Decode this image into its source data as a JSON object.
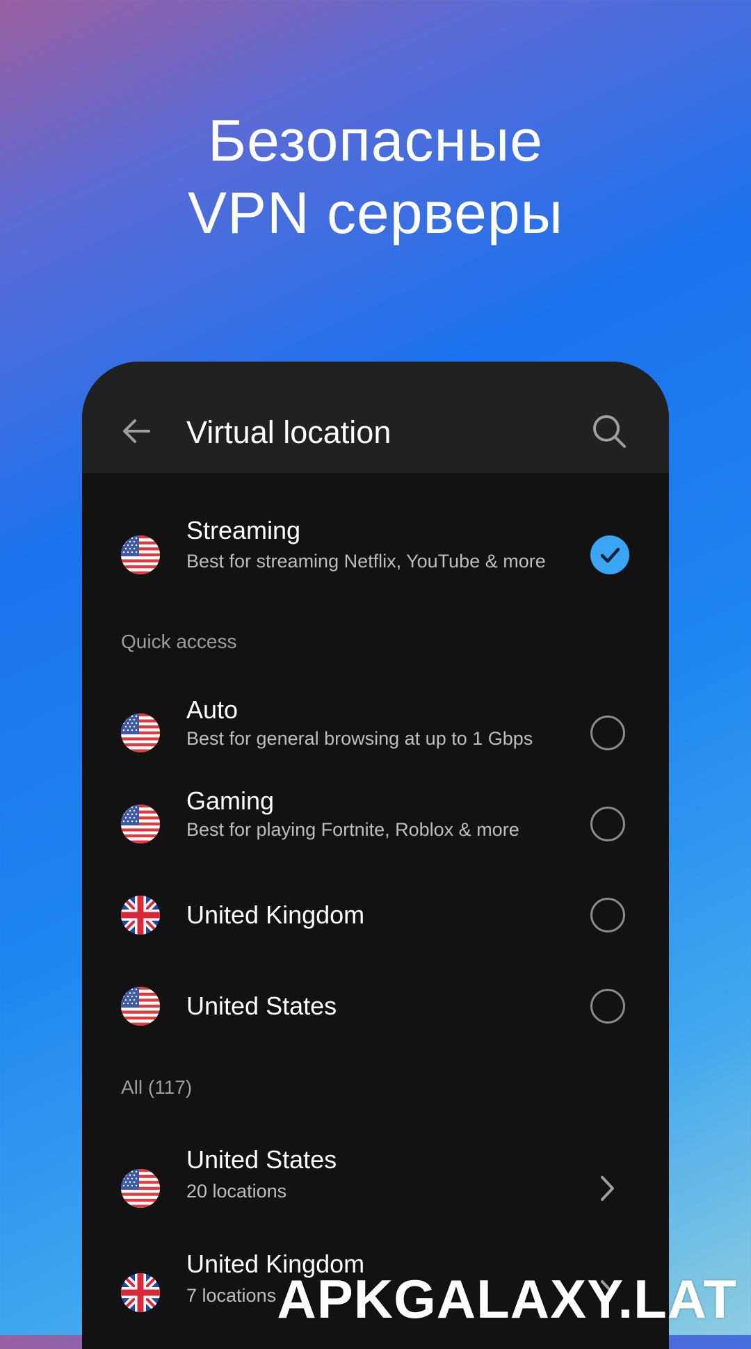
{
  "promo": {
    "line1": "Безопасные",
    "line2": "VPN серверы"
  },
  "appbar": {
    "title": "Virtual location",
    "back_icon": "arrow-left-icon",
    "search_icon": "search-icon"
  },
  "selected": {
    "title": "Streaming",
    "subtitle": "Best for streaming Netflix, YouTube & more",
    "flag": "us"
  },
  "quick_access": {
    "label": "Quick access",
    "items": [
      {
        "title": "Auto",
        "subtitle": "Best for general browsing at up to 1 Gbps",
        "flag": "us"
      },
      {
        "title": "Gaming",
        "subtitle": "Best for playing Fortnite, Roblox & more",
        "flag": "us"
      },
      {
        "title": "United Kingdom",
        "subtitle": "",
        "flag": "uk"
      },
      {
        "title": "United States",
        "subtitle": "",
        "flag": "us"
      }
    ]
  },
  "all": {
    "label": "All (117)",
    "items": [
      {
        "title": "United States",
        "subtitle": "20 locations",
        "flag": "us"
      },
      {
        "title": "United Kingdom",
        "subtitle": "7 locations",
        "flag": "uk"
      }
    ]
  },
  "watermark": "APKGALAXY.LAT",
  "colors": {
    "accent": "#3aa4f5",
    "card_bg": "#121212",
    "appbar_bg": "#212121"
  }
}
